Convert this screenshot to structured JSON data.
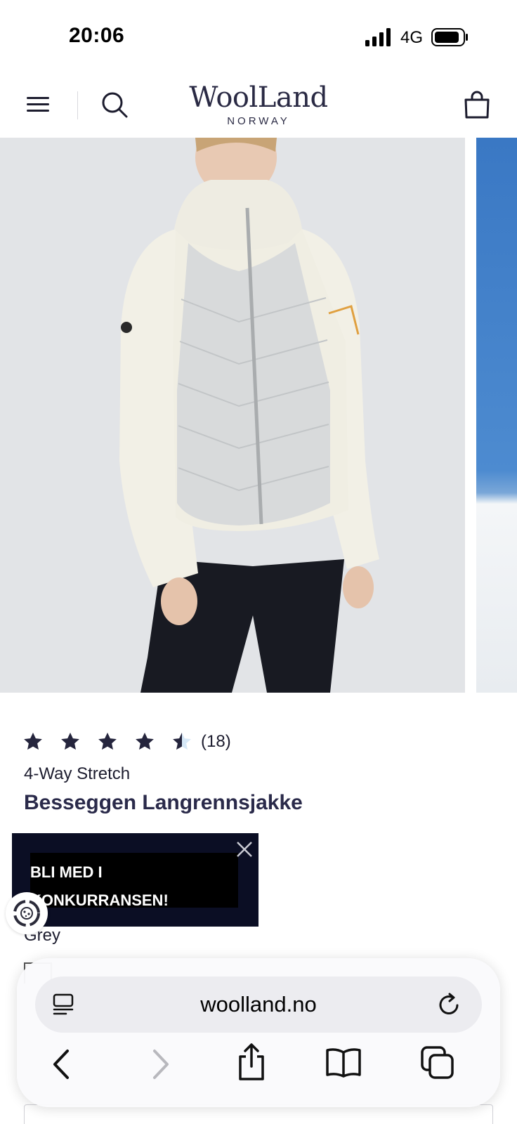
{
  "status_bar": {
    "time": "20:06",
    "network": "4G",
    "icons": [
      "signal-icon",
      "battery-icon"
    ]
  },
  "header": {
    "logo_main": "WoolLand",
    "logo_sub": "NORWAY",
    "icons": [
      "menu-icon",
      "search-icon",
      "shopping-bag-icon"
    ]
  },
  "gallery": {
    "images": [
      "product-photo-jacket-front",
      "product-photo-outdoor-snow"
    ]
  },
  "product": {
    "rating": 4.5,
    "rating_count": "(18)",
    "subtitle": "4-Way Stretch",
    "title": "Besseggen Langrennsjakke",
    "color_label": "Grey"
  },
  "promo_popup": {
    "text": "BLI MED I KONKURRANSEN!",
    "close_icon": "close-icon"
  },
  "browser": {
    "url": "woolland.no",
    "icons": [
      "reader-icon",
      "reload-icon",
      "back-icon",
      "forward-icon",
      "share-icon",
      "bookmarks-icon",
      "tabs-icon"
    ]
  },
  "colors": {
    "brand_navy": "#2a2a4a",
    "popup_bg": "#0b0e24",
    "star": "#25253d",
    "image_bg": "#e2e4e7"
  }
}
